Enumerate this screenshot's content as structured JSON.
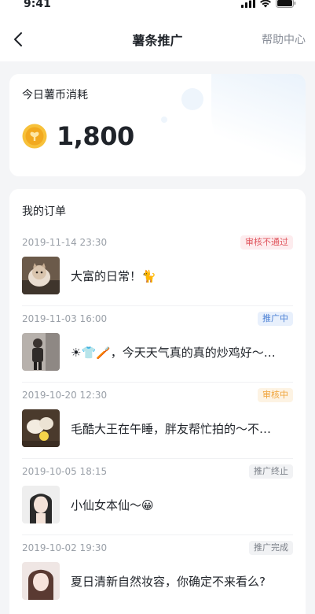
{
  "status_bar": {
    "time": "9:41"
  },
  "nav": {
    "title": "薯条推广",
    "help": "帮助中心"
  },
  "summary": {
    "label": "今日薯币消耗",
    "value": "1,800"
  },
  "orders": {
    "title": "我的订单",
    "items": [
      {
        "time": "2019-11-14  23:30",
        "status": "审核不通过",
        "text": "大富的日常！🐈",
        "status_color": "#e0565e",
        "status_bg": "#fdecee"
      },
      {
        "time": "2019-11-03  16:00",
        "status": "推广中",
        "text": "☀👕🪥，今天天气真的真的炒鸡好～…",
        "status_color": "#4a7fd4",
        "status_bg": "#e8f0fc"
      },
      {
        "time": "2019-10-20  12:30",
        "status": "审核中",
        "text": "毛酷大王在午睡，胖友帮忙拍的～不…",
        "status_color": "#f0a43a",
        "status_bg": "#fdf3e3"
      },
      {
        "time": "2019-10-05  18:15",
        "status": "推广终止",
        "text": "小仙女本仙～😀",
        "status_color": "#7d828a",
        "status_bg": "#f1f2f4"
      },
      {
        "time": "2019-10-02  19:30",
        "status": "推广完成",
        "text": "夏日清新自然妆容，你确定不来看么?",
        "status_color": "#7d828a",
        "status_bg": "#f1f2f4"
      }
    ]
  }
}
